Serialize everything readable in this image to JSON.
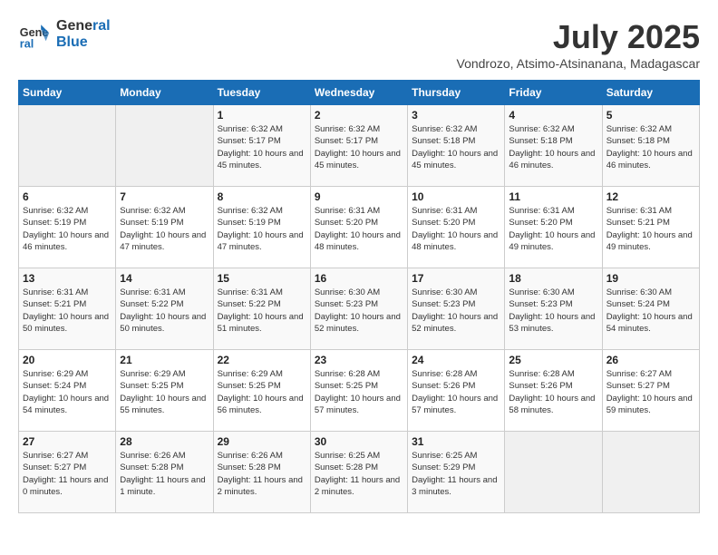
{
  "header": {
    "logo_line1": "General",
    "logo_line2": "Blue",
    "title": "July 2025",
    "subtitle": "Vondrozo, Atsimo-Atsinanana, Madagascar"
  },
  "weekdays": [
    "Sunday",
    "Monday",
    "Tuesday",
    "Wednesday",
    "Thursday",
    "Friday",
    "Saturday"
  ],
  "weeks": [
    [
      {
        "day": "",
        "info": ""
      },
      {
        "day": "",
        "info": ""
      },
      {
        "day": "1",
        "info": "Sunrise: 6:32 AM\nSunset: 5:17 PM\nDaylight: 10 hours and 45 minutes."
      },
      {
        "day": "2",
        "info": "Sunrise: 6:32 AM\nSunset: 5:17 PM\nDaylight: 10 hours and 45 minutes."
      },
      {
        "day": "3",
        "info": "Sunrise: 6:32 AM\nSunset: 5:18 PM\nDaylight: 10 hours and 45 minutes."
      },
      {
        "day": "4",
        "info": "Sunrise: 6:32 AM\nSunset: 5:18 PM\nDaylight: 10 hours and 46 minutes."
      },
      {
        "day": "5",
        "info": "Sunrise: 6:32 AM\nSunset: 5:18 PM\nDaylight: 10 hours and 46 minutes."
      }
    ],
    [
      {
        "day": "6",
        "info": "Sunrise: 6:32 AM\nSunset: 5:19 PM\nDaylight: 10 hours and 46 minutes."
      },
      {
        "day": "7",
        "info": "Sunrise: 6:32 AM\nSunset: 5:19 PM\nDaylight: 10 hours and 47 minutes."
      },
      {
        "day": "8",
        "info": "Sunrise: 6:32 AM\nSunset: 5:19 PM\nDaylight: 10 hours and 47 minutes."
      },
      {
        "day": "9",
        "info": "Sunrise: 6:31 AM\nSunset: 5:20 PM\nDaylight: 10 hours and 48 minutes."
      },
      {
        "day": "10",
        "info": "Sunrise: 6:31 AM\nSunset: 5:20 PM\nDaylight: 10 hours and 48 minutes."
      },
      {
        "day": "11",
        "info": "Sunrise: 6:31 AM\nSunset: 5:20 PM\nDaylight: 10 hours and 49 minutes."
      },
      {
        "day": "12",
        "info": "Sunrise: 6:31 AM\nSunset: 5:21 PM\nDaylight: 10 hours and 49 minutes."
      }
    ],
    [
      {
        "day": "13",
        "info": "Sunrise: 6:31 AM\nSunset: 5:21 PM\nDaylight: 10 hours and 50 minutes."
      },
      {
        "day": "14",
        "info": "Sunrise: 6:31 AM\nSunset: 5:22 PM\nDaylight: 10 hours and 50 minutes."
      },
      {
        "day": "15",
        "info": "Sunrise: 6:31 AM\nSunset: 5:22 PM\nDaylight: 10 hours and 51 minutes."
      },
      {
        "day": "16",
        "info": "Sunrise: 6:30 AM\nSunset: 5:23 PM\nDaylight: 10 hours and 52 minutes."
      },
      {
        "day": "17",
        "info": "Sunrise: 6:30 AM\nSunset: 5:23 PM\nDaylight: 10 hours and 52 minutes."
      },
      {
        "day": "18",
        "info": "Sunrise: 6:30 AM\nSunset: 5:23 PM\nDaylight: 10 hours and 53 minutes."
      },
      {
        "day": "19",
        "info": "Sunrise: 6:30 AM\nSunset: 5:24 PM\nDaylight: 10 hours and 54 minutes."
      }
    ],
    [
      {
        "day": "20",
        "info": "Sunrise: 6:29 AM\nSunset: 5:24 PM\nDaylight: 10 hours and 54 minutes."
      },
      {
        "day": "21",
        "info": "Sunrise: 6:29 AM\nSunset: 5:25 PM\nDaylight: 10 hours and 55 minutes."
      },
      {
        "day": "22",
        "info": "Sunrise: 6:29 AM\nSunset: 5:25 PM\nDaylight: 10 hours and 56 minutes."
      },
      {
        "day": "23",
        "info": "Sunrise: 6:28 AM\nSunset: 5:25 PM\nDaylight: 10 hours and 57 minutes."
      },
      {
        "day": "24",
        "info": "Sunrise: 6:28 AM\nSunset: 5:26 PM\nDaylight: 10 hours and 57 minutes."
      },
      {
        "day": "25",
        "info": "Sunrise: 6:28 AM\nSunset: 5:26 PM\nDaylight: 10 hours and 58 minutes."
      },
      {
        "day": "26",
        "info": "Sunrise: 6:27 AM\nSunset: 5:27 PM\nDaylight: 10 hours and 59 minutes."
      }
    ],
    [
      {
        "day": "27",
        "info": "Sunrise: 6:27 AM\nSunset: 5:27 PM\nDaylight: 11 hours and 0 minutes."
      },
      {
        "day": "28",
        "info": "Sunrise: 6:26 AM\nSunset: 5:28 PM\nDaylight: 11 hours and 1 minute."
      },
      {
        "day": "29",
        "info": "Sunrise: 6:26 AM\nSunset: 5:28 PM\nDaylight: 11 hours and 2 minutes."
      },
      {
        "day": "30",
        "info": "Sunrise: 6:25 AM\nSunset: 5:28 PM\nDaylight: 11 hours and 2 minutes."
      },
      {
        "day": "31",
        "info": "Sunrise: 6:25 AM\nSunset: 5:29 PM\nDaylight: 11 hours and 3 minutes."
      },
      {
        "day": "",
        "info": ""
      },
      {
        "day": "",
        "info": ""
      }
    ]
  ]
}
